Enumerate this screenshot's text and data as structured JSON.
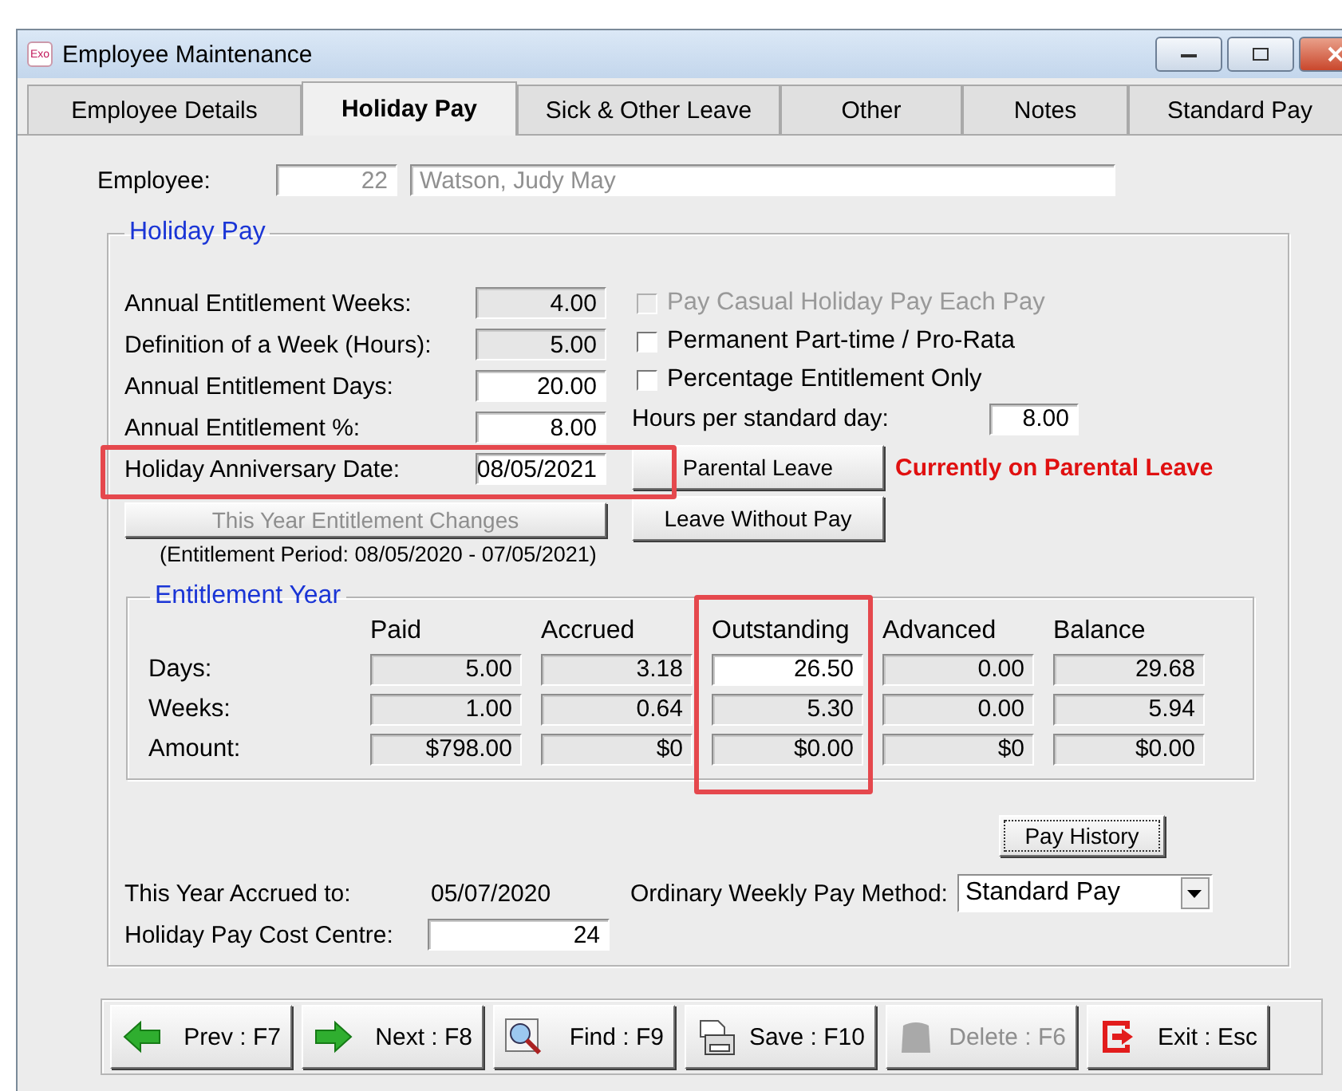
{
  "window": {
    "title": "Employee Maintenance",
    "icon_text": "Exo"
  },
  "tabs": [
    {
      "label": "Employee Details",
      "selected": false
    },
    {
      "label": "Holiday Pay",
      "selected": true
    },
    {
      "label": "Sick & Other Leave",
      "selected": false
    },
    {
      "label": "Other",
      "selected": false
    },
    {
      "label": "Notes",
      "selected": false
    },
    {
      "label": "Standard Pay",
      "selected": false
    }
  ],
  "employee": {
    "label": "Employee:",
    "number": "22",
    "name": "Watson, Judy May"
  },
  "holiday_pay": {
    "title": "Holiday Pay",
    "fields": [
      {
        "label": "Annual Entitlement Weeks:",
        "value": "4.00",
        "disabled": true,
        "highlighted": false
      },
      {
        "label": "Definition of a Week (Hours):",
        "value": "5.00",
        "disabled": true,
        "highlighted": false
      },
      {
        "label": "Annual Entitlement Days:",
        "value": "20.00",
        "disabled": false,
        "highlighted": false
      },
      {
        "label": "Annual Entitlement %:",
        "value": "8.00",
        "disabled": false,
        "highlighted": false
      },
      {
        "label": "Holiday Anniversary Date:",
        "value": "08/05/2021",
        "disabled": false,
        "highlighted": true
      }
    ],
    "options": [
      {
        "label": "Pay Casual Holiday Pay Each Pay",
        "checked": false,
        "disabled": true
      },
      {
        "label": "Permanent Part-time / Pro-Rata",
        "checked": false,
        "disabled": false
      },
      {
        "label": "Percentage Entitlement Only",
        "checked": false,
        "disabled": false
      }
    ],
    "hours_per_day": {
      "label": "Hours per standard day:",
      "value": "8.00"
    },
    "entitlement_changes_button": {
      "label": "This Year Entitlement Changes",
      "disabled": true
    },
    "entitlement_period": "(Entitlement Period: 08/05/2020 - 07/05/2021)",
    "leave_buttons": [
      {
        "label": "Parental Leave"
      },
      {
        "label": "Leave Without Pay"
      }
    ],
    "leave_status": "Currently on Parental Leave",
    "entitlement_year": {
      "title": "Entitlement Year",
      "columns": [
        {
          "label": "Paid",
          "highlighted": false
        },
        {
          "label": "Accrued",
          "highlighted": false
        },
        {
          "label": "Outstanding",
          "highlighted": true
        },
        {
          "label": "Advanced",
          "highlighted": false
        },
        {
          "label": "Balance",
          "highlighted": false
        }
      ],
      "rows": [
        {
          "label": "Days:",
          "cells": [
            {
              "value": "5.00",
              "disabled": true
            },
            {
              "value": "3.18",
              "disabled": true
            },
            {
              "value": "26.50",
              "disabled": false
            },
            {
              "value": "0.00",
              "disabled": true
            },
            {
              "value": "29.68",
              "disabled": true
            }
          ]
        },
        {
          "label": "Weeks:",
          "cells": [
            {
              "value": "1.00",
              "disabled": true
            },
            {
              "value": "0.64",
              "disabled": true
            },
            {
              "value": "5.30",
              "disabled": true
            },
            {
              "value": "0.00",
              "disabled": true
            },
            {
              "value": "5.94",
              "disabled": true
            }
          ]
        },
        {
          "label": "Amount:",
          "cells": [
            {
              "value": "$798.00",
              "disabled": true
            },
            {
              "value": "$0",
              "disabled": true
            },
            {
              "value": "$0.00",
              "disabled": true
            },
            {
              "value": "$0",
              "disabled": true
            },
            {
              "value": "$0.00",
              "disabled": true
            }
          ]
        }
      ]
    },
    "pay_history_button": "Pay History",
    "accrued": {
      "label": "This Year Accrued to:",
      "value": "05/07/2020"
    },
    "pay_method": {
      "label": "Ordinary Weekly Pay Method:",
      "value": "Standard Pay"
    },
    "cost_centre": {
      "label": "Holiday Pay Cost Centre:",
      "value": "24"
    }
  },
  "toolbar": [
    {
      "label": "Prev : F7",
      "kind": "prev",
      "disabled": false
    },
    {
      "label": "Next : F8",
      "kind": "next",
      "disabled": false
    },
    {
      "label": "Find : F9",
      "kind": "find",
      "disabled": false
    },
    {
      "label": "Save : F10",
      "kind": "save",
      "disabled": false
    },
    {
      "label": "Delete : F6",
      "kind": "delete",
      "disabled": true
    },
    {
      "label": "Exit : Esc",
      "kind": "exit",
      "disabled": false
    }
  ]
}
